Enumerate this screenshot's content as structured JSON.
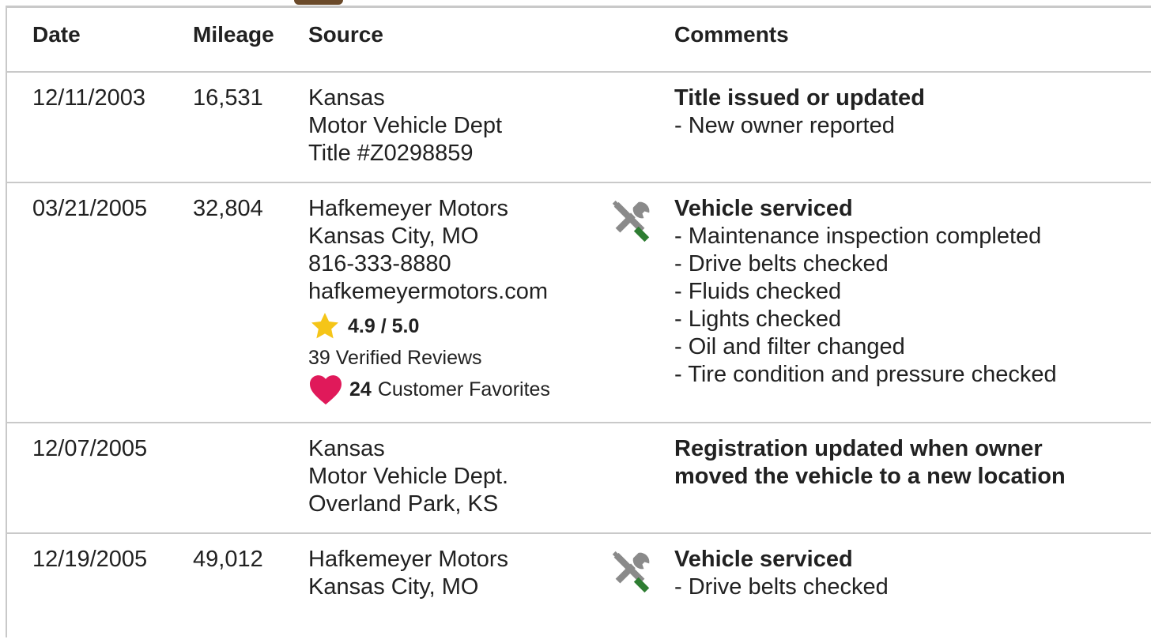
{
  "headers": {
    "date": "Date",
    "mileage": "Mileage",
    "source": "Source",
    "comments": "Comments"
  },
  "records": [
    {
      "date": "12/11/2003",
      "mileage": "16,531",
      "source": [
        "Kansas",
        "Motor Vehicle Dept",
        "Title #Z0298859"
      ],
      "comment_title": "Title issued or updated",
      "comment_items": [
        "New owner reported"
      ]
    },
    {
      "date": "03/21/2005",
      "mileage": "32,804",
      "source": [
        "Hafkemeyer Motors",
        "Kansas City, MO",
        "816-333-8880",
        "hafkemeyermotors.com"
      ],
      "rating": "4.9 / 5.0",
      "reviews": "39 Verified Reviews",
      "favorites_count": "24",
      "favorites_label": "Customer Favorites",
      "icon": "service-wrench-icon",
      "comment_title": "Vehicle serviced",
      "comment_items": [
        "Maintenance inspection completed",
        "Drive belts checked",
        "Fluids checked",
        "Lights checked",
        "Oil and filter changed",
        "Tire condition and pressure checked"
      ]
    },
    {
      "date": "12/07/2005",
      "mileage": "",
      "source": [
        "Kansas",
        "Motor Vehicle Dept.",
        "Overland Park, KS"
      ],
      "comment_title_lines": [
        "Registration updated when owner",
        "moved the vehicle to a new location"
      ]
    },
    {
      "date": "12/19/2005",
      "mileage": "49,012",
      "source": [
        "Hafkemeyer Motors",
        "Kansas City, MO"
      ],
      "icon": "service-wrench-icon",
      "comment_title": "Vehicle serviced",
      "comment_items": [
        "Drive belts checked"
      ]
    }
  ],
  "colors": {
    "border": "#c9c9c9",
    "star": "#f5c518",
    "heart": "#e0195a",
    "wrench_grey": "#8a8a8a",
    "screwdriver_green": "#2e7d32"
  }
}
